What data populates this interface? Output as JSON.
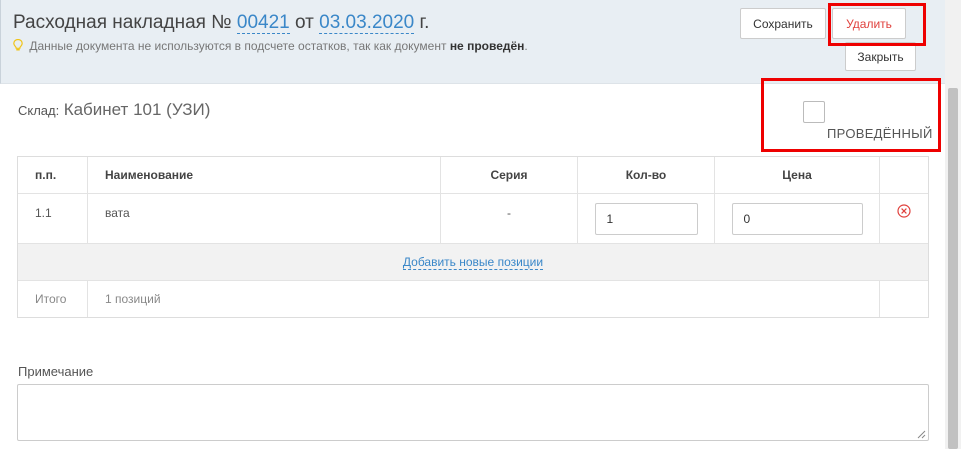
{
  "document": {
    "title_prefix": "Расходная накладная №",
    "number": "00421",
    "from": "от",
    "date": "03.03.2020",
    "suffix": "г.",
    "notice_text": "Данные документа не используются в подсчете остатков, так как документ",
    "notice_bold": "не проведён",
    "notice_end": "."
  },
  "buttons": {
    "save": "Сохранить",
    "delete": "Удалить",
    "close": "Закрыть"
  },
  "warehouse": {
    "label": "Склад:",
    "value": "Кабинет 101 (УЗИ)"
  },
  "posted": {
    "label": "ПРОВЕДЁННЫЙ",
    "checked": false
  },
  "table": {
    "headers": [
      "п.п.",
      "Наименование",
      "Серия",
      "Кол-во",
      "Цена"
    ],
    "rows": [
      {
        "num": "1.1",
        "name": "вата",
        "series": "-",
        "qty": "1",
        "price": "0"
      }
    ],
    "add_link": "Добавить новые позиции",
    "totals_label": "Итого",
    "totals_value": "1 позиций"
  },
  "note": {
    "label": "Примечание",
    "value": ""
  },
  "colors": {
    "accent": "#3a87c8",
    "danger": "#e0413d",
    "highlight": "#ee0000",
    "header_bg": "#e8eef3"
  }
}
